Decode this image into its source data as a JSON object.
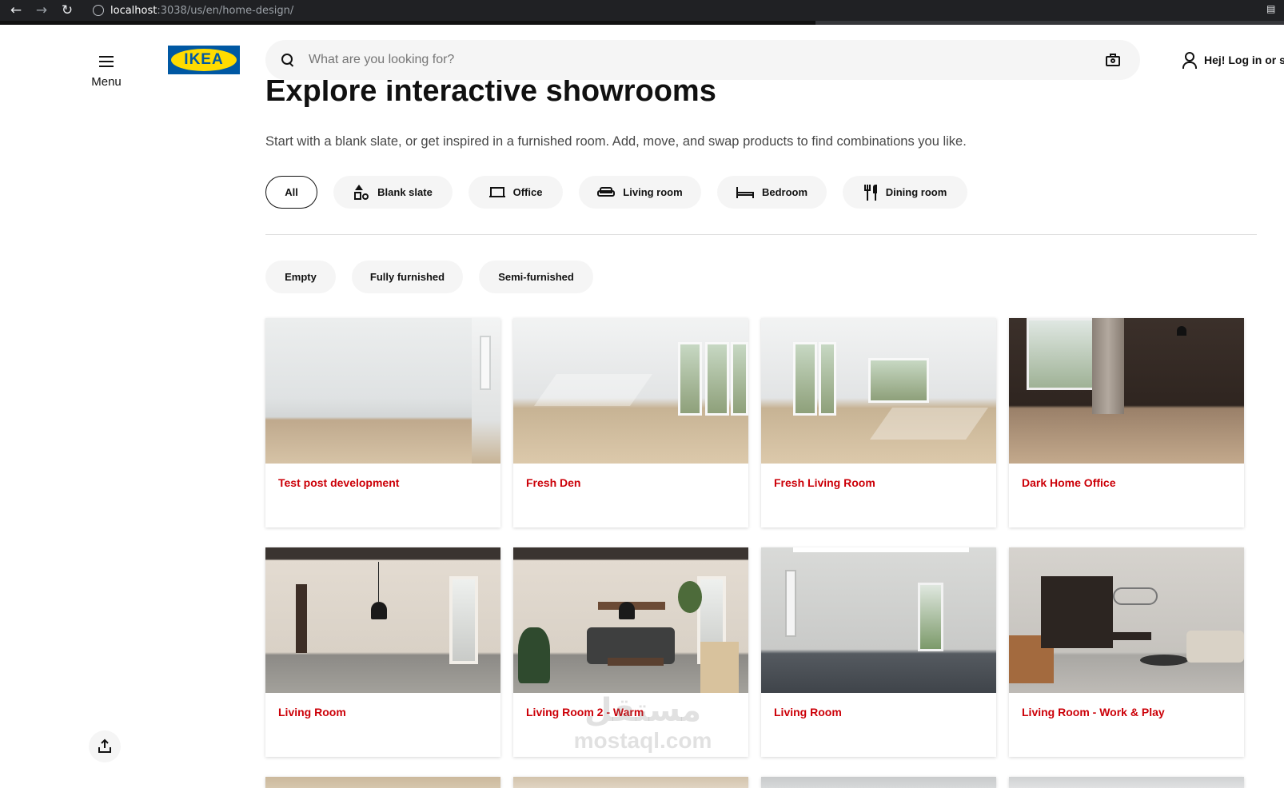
{
  "browser": {
    "url_host": "localhost",
    "url_path": ":3038/us/en/home-design/"
  },
  "header": {
    "menu_label": "Menu",
    "logo_text": "IKEA",
    "search_placeholder": "What are you looking for?",
    "login_text": "Hej! Log in or s"
  },
  "main": {
    "title": "Explore interactive showrooms",
    "subtitle": "Start with a blank slate, or get inspired in a furnished room. Add, move, and swap products to find combinations you like.",
    "room_filters": [
      {
        "label": "All",
        "icon": "none",
        "active": true
      },
      {
        "label": "Blank slate",
        "icon": "shapes-icon"
      },
      {
        "label": "Office",
        "icon": "desk-icon"
      },
      {
        "label": "Living room",
        "icon": "sofa-icon"
      },
      {
        "label": "Bedroom",
        "icon": "bed-icon"
      },
      {
        "label": "Dining room",
        "icon": "cutlery-icon"
      }
    ],
    "furnish_filters": [
      {
        "label": "Empty"
      },
      {
        "label": "Fully furnished"
      },
      {
        "label": "Semi-furnished"
      }
    ],
    "cards": [
      {
        "title": "Test post development"
      },
      {
        "title": "Fresh Den"
      },
      {
        "title": "Fresh Living Room"
      },
      {
        "title": "Dark Home Office"
      },
      {
        "title": "Living Room"
      },
      {
        "title": "Living Room 2 - Warm"
      },
      {
        "title": "Living Room"
      },
      {
        "title": "Living Room - Work & Play"
      }
    ]
  },
  "watermark": {
    "arabic": "مستقل",
    "latin": "mostaql.com"
  },
  "colors": {
    "brand_blue": "#0058a3",
    "brand_yellow": "#ffdb00",
    "card_title_red": "#cc0008",
    "pill_bg": "#f5f5f5"
  }
}
